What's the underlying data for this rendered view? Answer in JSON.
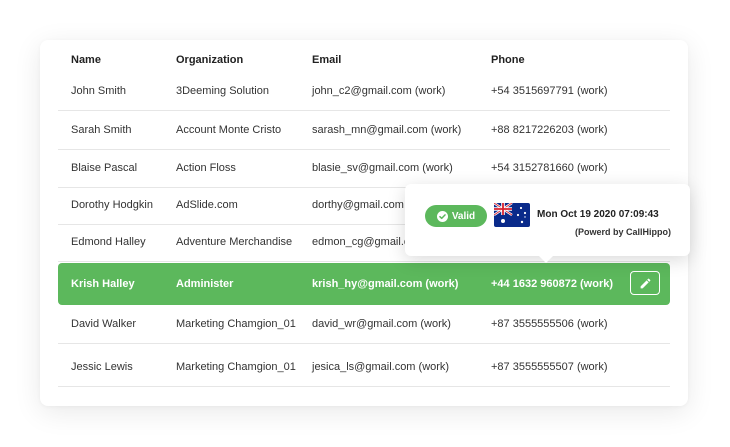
{
  "table": {
    "headers": {
      "name": "Name",
      "organization": "Organization",
      "email": "Email",
      "phone": "Phone"
    },
    "rows": [
      {
        "name": "John Smith",
        "organization": "3Deeming Solution",
        "email": "john_c2@gmail.com (work)",
        "phone": "+54 3515697791 (work)"
      },
      {
        "name": "Sarah Smith",
        "organization": "Account Monte Cristo",
        "email": "sarash_mn@gmail.com (work)",
        "phone": "+88 8217226203 (work)"
      },
      {
        "name": "Blaise Pascal",
        "organization": "Action Floss",
        "email": "blasie_sv@gmail.com (work)",
        "phone": "+54 3152781660 (work)"
      },
      {
        "name": "Dorothy Hodgkin",
        "organization": "AdSlide.com",
        "email": "dorthy@gmail.com",
        "phone": ""
      },
      {
        "name": "Edmond Halley",
        "organization": "Adventure Merchandise",
        "email": "edmon_cg@gmail.c",
        "phone": ""
      },
      {
        "name": "Krish Halley",
        "organization": "Administer",
        "email": "krish_hy@gmail.com (work)",
        "phone": "+44 1632 960872 (work)"
      },
      {
        "name": "David Walker",
        "organization": "Marketing Chamgion_01",
        "email": "david_wr@gmail.com (work)",
        "phone": "+87 3555555506 (work)"
      },
      {
        "name": "Jessic Lewis",
        "organization": "Marketing Chamgion_01",
        "email": "jesica_ls@gmail.com (work)",
        "phone": "+87 3555555507 (work)"
      }
    ]
  },
  "tooltip": {
    "badge_label": "Valid",
    "datetime": "Mon  Oct 19 2020  07:09:43",
    "powered_by": "(Powerd by CallHippo)",
    "flag_icon": "australia-flag-icon"
  },
  "colors": {
    "accent": "#5cb85c",
    "flag_blue": "#0a2a8a",
    "flag_red": "#d8202f"
  }
}
